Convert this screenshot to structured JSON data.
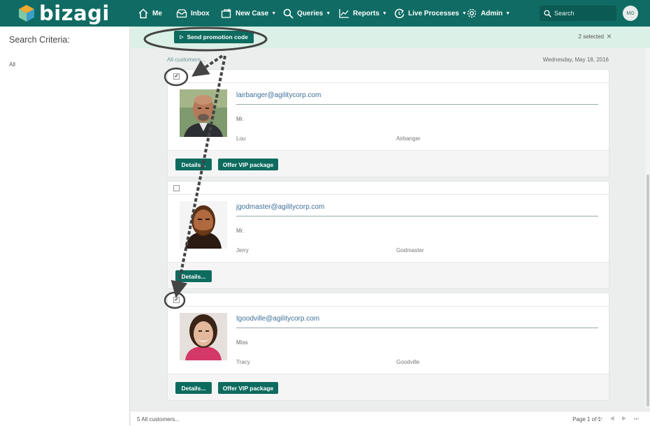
{
  "app": {
    "name": "bizagi"
  },
  "nav": {
    "me": "Me",
    "inbox": "Inbox",
    "new_case": "New Case",
    "queries": "Queries",
    "reports": "Reports",
    "live_processes": "Live Processes",
    "admin": "Admin"
  },
  "search": {
    "placeholder": "Search"
  },
  "user": {
    "initials": "MG"
  },
  "sidebar": {
    "title": "Search Criteria:",
    "filter": "All"
  },
  "actionbar": {
    "send_label": "Send promotion code",
    "selected": "2 selected",
    "close": "×"
  },
  "list": {
    "breadcrumb": "All customers...",
    "date": "Wednesday, May 18, 2016",
    "customers": [
      {
        "email": "lairbanger@agilitycorp.com",
        "title": "Mr.",
        "first": "Lou",
        "last": "Airbanger",
        "checked": true,
        "checkmark": "✔",
        "details": "Details...",
        "vip": "Offer VIP package"
      },
      {
        "email": "jgodmaster@agilitycorp.com",
        "title": "Mr.",
        "first": "Jerry",
        "last": "Godmaster",
        "checked": false,
        "checkmark": "",
        "details": "Details..."
      },
      {
        "email": "tgoodville@agilitycorp.com",
        "title": "Miss",
        "first": "Tracy",
        "last": "Goodville",
        "checked": true,
        "checkmark": "✔",
        "details": "Details...",
        "vip": "Offer VIP package"
      }
    ]
  },
  "footer": {
    "count": "5 All customers...",
    "page": "Page 1 of 1",
    "pager": "⏮ ◀ ▶ ⏭"
  },
  "colors": {
    "brand": "#0f6b63",
    "button": "#0d6b5f",
    "actionbar": "#dbf0e7"
  }
}
